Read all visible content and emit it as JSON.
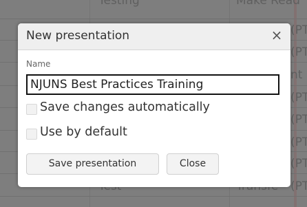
{
  "background": {
    "header_left": "Testing",
    "header_right": "Make Read",
    "right_cells": [
      "(PT",
      "(PT",
      "nt",
      "(PT",
      "(PT",
      "(PT",
      "(PT",
      "(PT"
    ],
    "bottom_left": "Test",
    "bottom_right": "Transfe"
  },
  "dialog": {
    "title": "New presentation",
    "close_glyph": "×",
    "name_label": "Name",
    "name_value": "NJUNS Best Practices Training",
    "options": [
      {
        "label": "Save changes automatically",
        "checked": false
      },
      {
        "label": "Use by default",
        "checked": false
      }
    ],
    "buttons": {
      "save_label": "Save presentation",
      "close_label": "Close"
    }
  }
}
